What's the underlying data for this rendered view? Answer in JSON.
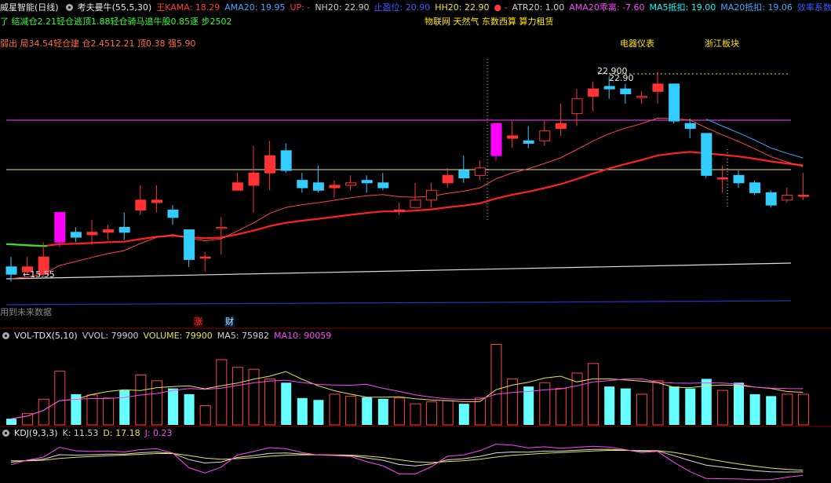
{
  "header": {
    "title": "威星智能(日线)",
    "indicator": "考夫曼牛(55,5,30)",
    "items": [
      {
        "text": "王KAMA: 18.29",
        "color": "#ff3b3b"
      },
      {
        "text": "AMA20: 19.95",
        "color": "#3fa9ff"
      },
      {
        "text": "UP: -",
        "color": "#ff3b3b"
      },
      {
        "text": "NH20: 22.90",
        "color": "#cfcfcf"
      },
      {
        "text": "止盈位: 20.90",
        "color": "#3b5bff"
      },
      {
        "text": "HH20: 22.90",
        "color": "#e6e64a"
      },
      {
        "text": "● -",
        "color": "#ff3b3b"
      },
      {
        "text": "ATR20: 1.00",
        "color": "#cfcfcf"
      },
      {
        "text": "AMA20乖离: -7.60",
        "color": "#ff44ff"
      },
      {
        "text": "MA5抵扣: 19.00",
        "color": "#00ffff"
      },
      {
        "text": "MA20抵扣: 19.06",
        "color": "#3fa9ff"
      },
      {
        "text": "效率系数:",
        "color": "#3b5bff"
      }
    ]
  },
  "line2": "了 结减仓2.21轻仓逃顶1.88轻仓骑马追牛股0.85逐 步2502",
  "line3": "弱出 局34.54轻仓建 仓2.4512.21 顶0.38 强5.90",
  "concepts": "物联网 天然气 东数西算 算力租赁",
  "tag1": "电器仪表",
  "tag2": "浙江板块",
  "future_note": "用到未来数据",
  "badge_zhang": "涨",
  "badge_cai": "财",
  "price_high_label": "22.900",
  "price_high_label2": "22.90",
  "price_low_label": "15.55",
  "vol_header": {
    "name": "VOL-TDX(5,10)",
    "items": [
      {
        "text": "VVOL: 79900",
        "color": "#cfcfcf"
      },
      {
        "text": "VOLUME: 79900",
        "color": "#e6e64a"
      },
      {
        "text": "MA5: 75982",
        "color": "#cfcfcf"
      },
      {
        "text": "MA10: 90059",
        "color": "#ff44ff"
      }
    ]
  },
  "kdj_header": {
    "name": "KDJ(9,3,3)",
    "items": [
      {
        "text": "K: 11.53",
        "color": "#cfcfcf"
      },
      {
        "text": "D: 17.18",
        "color": "#e6e64a"
      },
      {
        "text": "J: 0.23",
        "color": "#ff44ff"
      }
    ]
  },
  "colors": {
    "up": "#ff3333",
    "down": "#33ccff",
    "limit": "#ff00ff",
    "bg": "#000000"
  },
  "chart_data": {
    "type": "candlestick",
    "candles": [
      {
        "o": 16.2,
        "c": 15.9,
        "h": 16.6,
        "l": 15.6,
        "v": 16000
      },
      {
        "o": 16.0,
        "c": 16.2,
        "h": 16.6,
        "l": 15.9,
        "v": 30000
      },
      {
        "o": 15.9,
        "c": 16.6,
        "h": 17.2,
        "l": 15.8,
        "v": 67000
      },
      {
        "o": 17.2,
        "c": 18.4,
        "h": 18.4,
        "l": 17.0,
        "v": 140000,
        "lim": true
      },
      {
        "o": 17.6,
        "c": 17.4,
        "h": 17.8,
        "l": 17.2,
        "v": 80000
      },
      {
        "o": 17.5,
        "c": 17.6,
        "h": 18.1,
        "l": 17.1,
        "v": 78000
      },
      {
        "o": 17.6,
        "c": 17.7,
        "h": 17.9,
        "l": 17.3,
        "v": 70000
      },
      {
        "o": 17.8,
        "c": 17.6,
        "h": 18.4,
        "l": 17.3,
        "v": 90000
      },
      {
        "o": 18.5,
        "c": 18.9,
        "h": 19.5,
        "l": 18.3,
        "v": 130000
      },
      {
        "o": 18.8,
        "c": 18.9,
        "h": 19.5,
        "l": 18.4,
        "v": 115000
      },
      {
        "o": 18.5,
        "c": 18.2,
        "h": 18.7,
        "l": 17.9,
        "v": 95000
      },
      {
        "o": 17.7,
        "c": 16.5,
        "h": 17.7,
        "l": 16.2,
        "v": 80000
      },
      {
        "o": 16.6,
        "c": 16.6,
        "h": 16.8,
        "l": 16.0,
        "v": 50000
      },
      {
        "o": 17.8,
        "c": 17.8,
        "h": 18.2,
        "l": 16.7,
        "v": 170000
      },
      {
        "o": 19.3,
        "c": 19.6,
        "h": 20.0,
        "l": 19.3,
        "v": 150000
      },
      {
        "o": 19.5,
        "c": 20.0,
        "h": 21.1,
        "l": 18.4,
        "v": 145000
      },
      {
        "o": 20.0,
        "c": 20.7,
        "h": 21.3,
        "l": 19.3,
        "v": 120000
      },
      {
        "o": 20.9,
        "c": 20.1,
        "h": 21.2,
        "l": 20.0,
        "v": 110000
      },
      {
        "o": 19.7,
        "c": 19.4,
        "h": 20.0,
        "l": 19.2,
        "v": 70000
      },
      {
        "o": 19.6,
        "c": 19.3,
        "h": 20.3,
        "l": 19.2,
        "v": 65000
      },
      {
        "o": 19.4,
        "c": 19.5,
        "h": 19.7,
        "l": 19.0,
        "v": 80000
      },
      {
        "o": 19.5,
        "c": 19.6,
        "h": 19.9,
        "l": 19.3,
        "v": 75000
      },
      {
        "o": 19.7,
        "c": 19.6,
        "h": 19.9,
        "l": 19.2,
        "v": 72000
      },
      {
        "o": 19.6,
        "c": 19.4,
        "h": 20.0,
        "l": 19.3,
        "v": 68000
      },
      {
        "o": 18.5,
        "c": 18.5,
        "h": 18.8,
        "l": 18.3,
        "v": 70000
      },
      {
        "o": 18.6,
        "c": 18.9,
        "h": 19.6,
        "l": 18.6,
        "v": 55000
      },
      {
        "o": 18.9,
        "c": 19.3,
        "h": 19.6,
        "l": 18.6,
        "v": 60000
      },
      {
        "o": 19.6,
        "c": 19.9,
        "h": 20.2,
        "l": 19.4,
        "v": 63000
      },
      {
        "o": 20.1,
        "c": 19.8,
        "h": 20.7,
        "l": 19.6,
        "v": 55000
      },
      {
        "o": 19.9,
        "c": 20.2,
        "h": 20.5,
        "l": 19.7,
        "v": 70000
      },
      {
        "o": 20.7,
        "c": 22.0,
        "h": 22.0,
        "l": 20.5,
        "v": 210000,
        "lim": true
      },
      {
        "o": 21.4,
        "c": 21.5,
        "h": 22.1,
        "l": 21.0,
        "v": 120000
      },
      {
        "o": 21.3,
        "c": 21.2,
        "h": 21.9,
        "l": 21.0,
        "v": 100000
      },
      {
        "o": 21.3,
        "c": 21.7,
        "h": 22.1,
        "l": 21.1,
        "v": 110000
      },
      {
        "o": 21.8,
        "c": 22.0,
        "h": 22.8,
        "l": 21.5,
        "v": 95000
      },
      {
        "o": 22.4,
        "c": 23.0,
        "h": 23.4,
        "l": 21.9,
        "v": 135000
      },
      {
        "o": 23.1,
        "c": 23.4,
        "h": 23.7,
        "l": 22.5,
        "v": 160000
      },
      {
        "o": 23.5,
        "c": 23.4,
        "h": 23.9,
        "l": 23.0,
        "v": 100000
      },
      {
        "o": 23.4,
        "c": 23.2,
        "h": 23.6,
        "l": 22.8,
        "v": 95000
      },
      {
        "o": 23.1,
        "c": 23.1,
        "h": 23.3,
        "l": 22.8,
        "v": 80000
      },
      {
        "o": 23.3,
        "c": 23.6,
        "h": 24.1,
        "l": 22.8,
        "v": 115000
      },
      {
        "o": 23.6,
        "c": 22.1,
        "h": 23.6,
        "l": 22.0,
        "v": 100000
      },
      {
        "o": 22.0,
        "c": 21.8,
        "h": 22.2,
        "l": 21.4,
        "v": 95000
      },
      {
        "o": 21.6,
        "c": 19.9,
        "h": 21.6,
        "l": 19.8,
        "v": 120000
      },
      {
        "o": 19.8,
        "c": 19.8,
        "h": 20.3,
        "l": 19.2,
        "v": 90000
      },
      {
        "o": 19.9,
        "c": 19.6,
        "h": 20.1,
        "l": 19.4,
        "v": 110000
      },
      {
        "o": 19.6,
        "c": 19.2,
        "h": 19.7,
        "l": 19.1,
        "v": 80000
      },
      {
        "o": 19.2,
        "c": 18.7,
        "h": 19.3,
        "l": 18.6,
        "v": 75000
      },
      {
        "o": 18.9,
        "c": 19.1,
        "h": 19.4,
        "l": 18.8,
        "v": 80000
      },
      {
        "o": 19.1,
        "c": 19.1,
        "h": 20.0,
        "l": 18.9,
        "v": 79900
      }
    ]
  }
}
